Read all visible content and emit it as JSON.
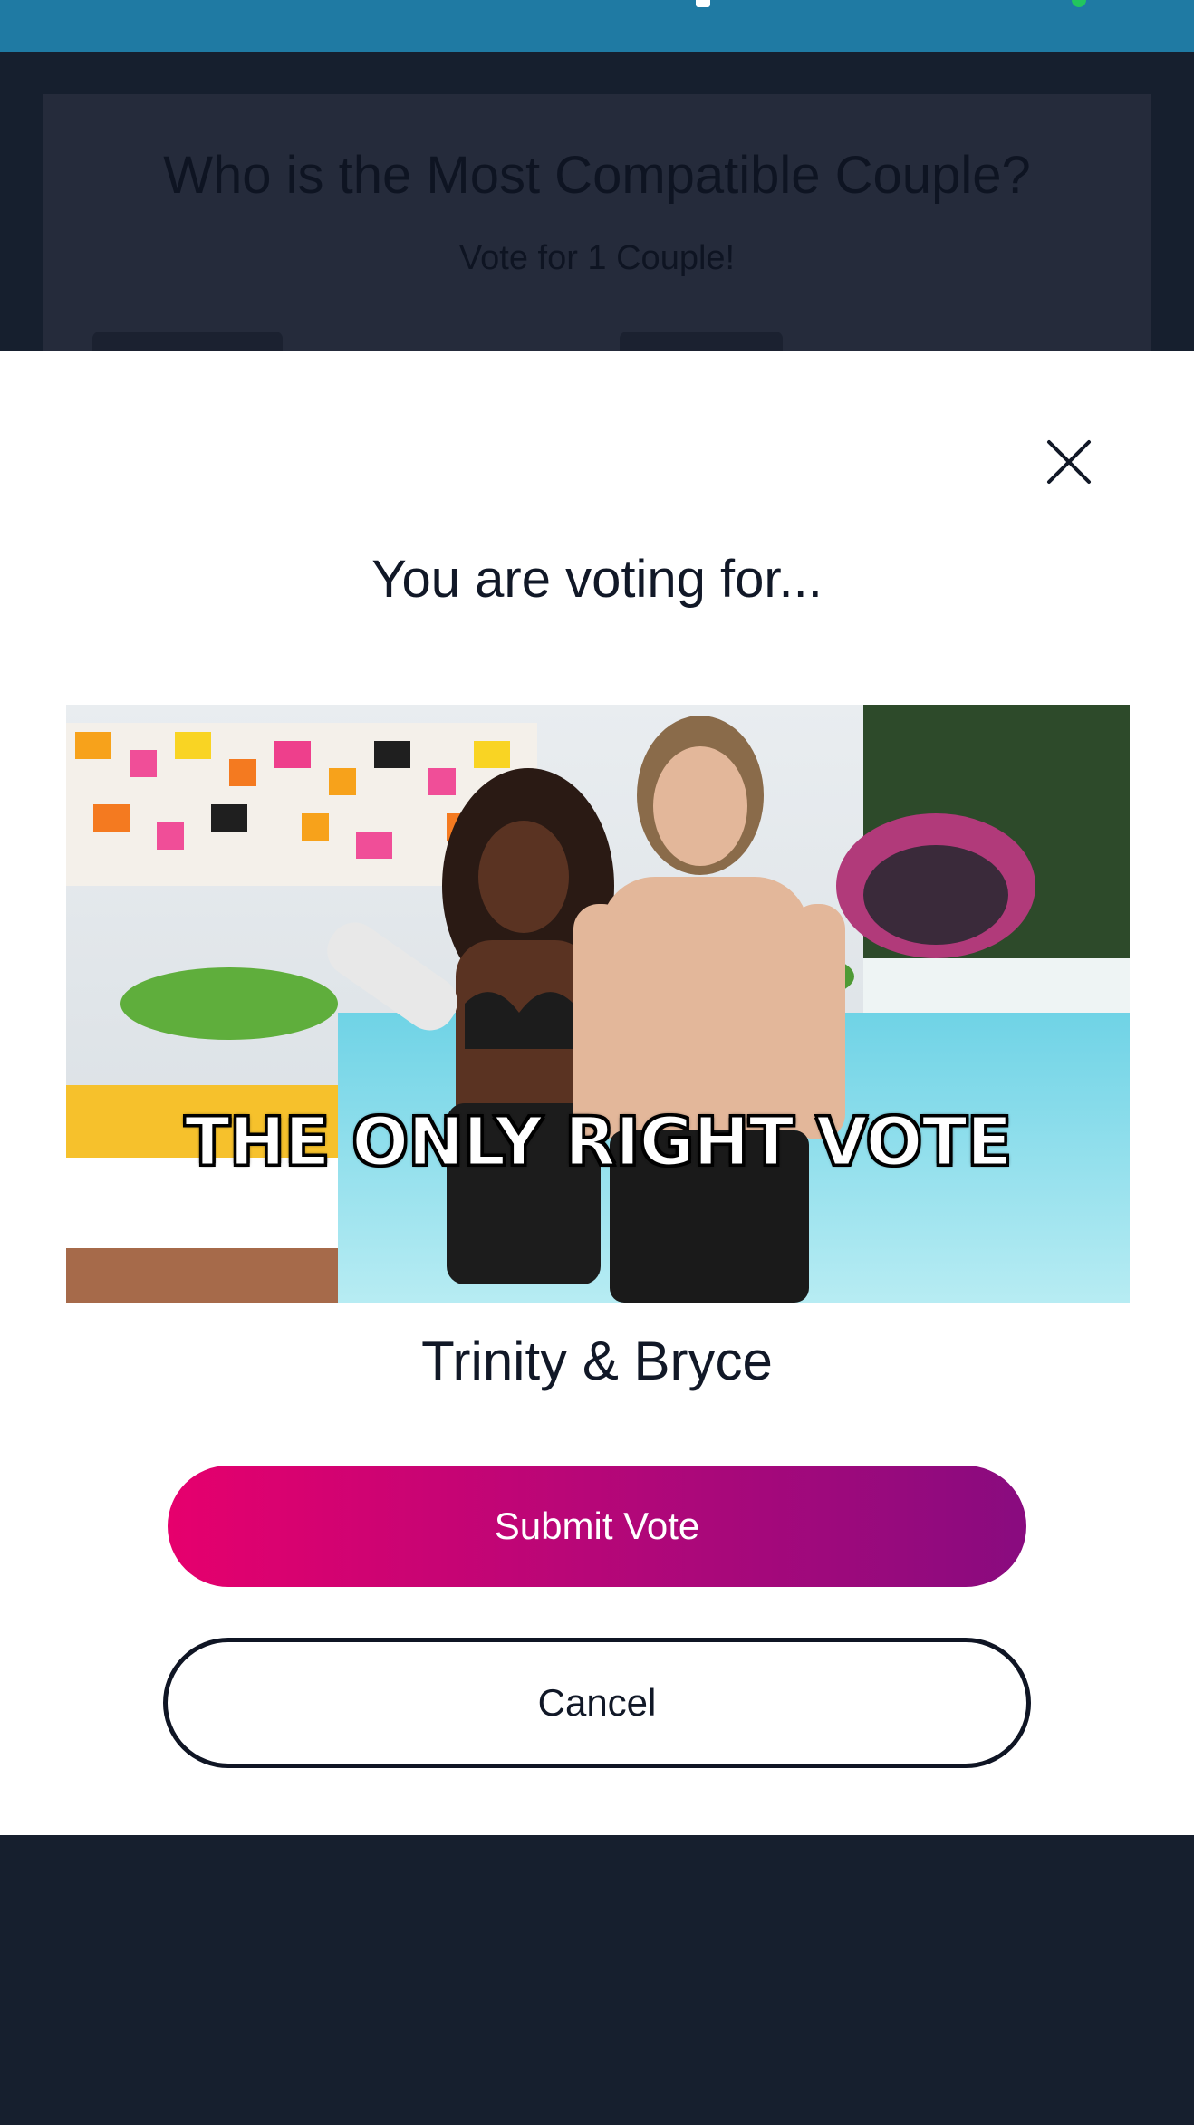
{
  "background": {
    "title": "Who is the Most Compatible Couple?",
    "subtitle": "Vote for 1 Couple!"
  },
  "modal": {
    "title": "You are voting for...",
    "close_icon": "close-icon",
    "photo_caption": "THE ONLY RIGHT VOTE",
    "couple_name": "Trinity & Bryce",
    "submit_label": "Submit Vote",
    "cancel_label": "Cancel"
  },
  "colors": {
    "topbar": "#1f7aa3",
    "page_background": "#161f2e",
    "submit_gradient_start": "#e6006d",
    "submit_gradient_end": "#890b7f",
    "status_dot": "#22c55e"
  }
}
